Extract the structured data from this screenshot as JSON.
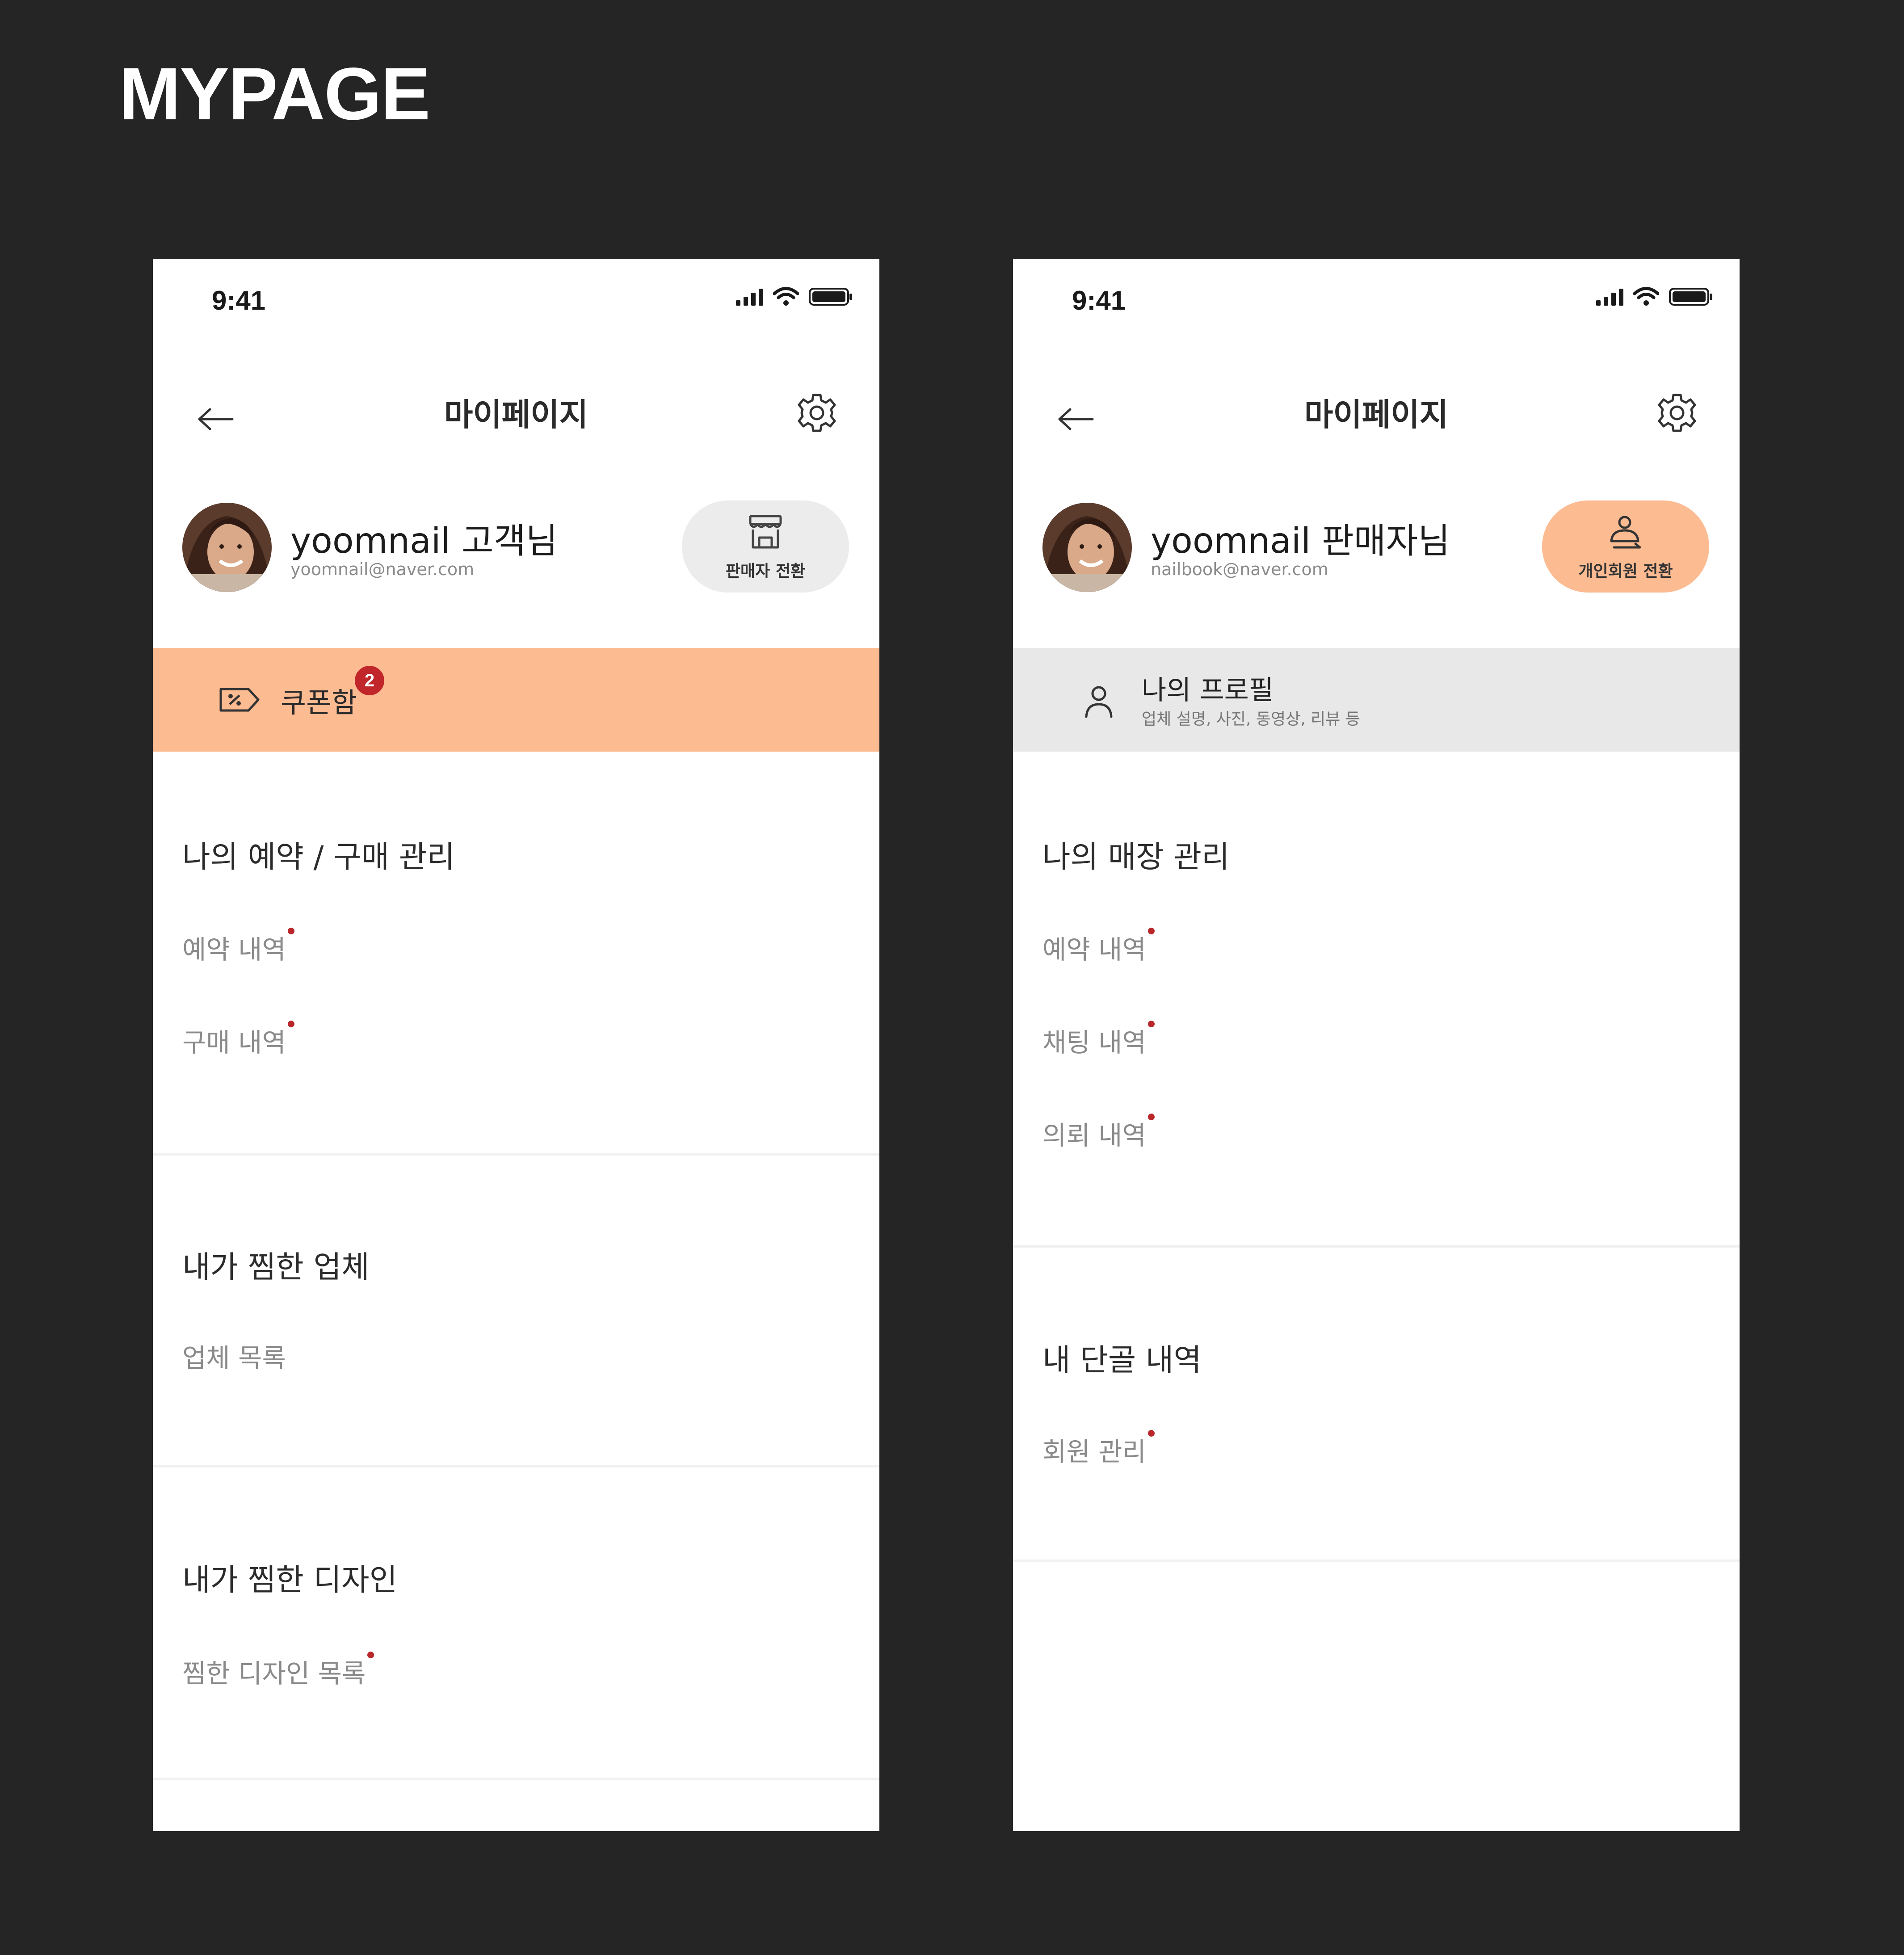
{
  "page_title": "MYPAGE",
  "colors": {
    "accent": "#fdbb92",
    "badge": "#c0262a",
    "background": "#252525"
  },
  "customer_screen": {
    "status": {
      "time": "9:41"
    },
    "nav": {
      "title": "마이페이지",
      "back_icon": "arrow-left-icon",
      "settings_icon": "gear-icon"
    },
    "profile": {
      "name": "yoomnail 고객님",
      "email": "yoomnail@naver.com"
    },
    "switch_button": {
      "label": "판매자 전환",
      "icon": "store-icon"
    },
    "coupon": {
      "label": "쿠폰함",
      "badge": "2",
      "icon": "coupon-tag-icon"
    },
    "sections": [
      {
        "title": "나의 예약 / 구매 관리",
        "items": [
          "예약 내역",
          "구매 내역"
        ]
      },
      {
        "title": "내가 찜한 업체",
        "items": [
          "업체 목록"
        ]
      },
      {
        "title": "내가 찜한 디자인",
        "items": [
          "찜한 디자인 목록"
        ]
      }
    ]
  },
  "seller_screen": {
    "status": {
      "time": "9:41"
    },
    "nav": {
      "title": "마이페이지",
      "back_icon": "arrow-left-icon",
      "settings_icon": "gear-icon"
    },
    "profile": {
      "name": "yoomnail 판매자님",
      "email": "nailbook@naver.com"
    },
    "switch_button": {
      "label": "개인회원 전환",
      "icon": "user-switch-icon"
    },
    "my_profile": {
      "title": "나의 프로필",
      "subtitle": "업체 설명, 사진, 동영상, 리뷰 등",
      "icon": "person-icon"
    },
    "sections": [
      {
        "title": "나의 매장 관리",
        "items": [
          "예약 내역",
          "채팅 내역",
          "의뢰 내역"
        ]
      },
      {
        "title": "내 단골 내역",
        "items": [
          "회원 관리"
        ]
      }
    ]
  }
}
